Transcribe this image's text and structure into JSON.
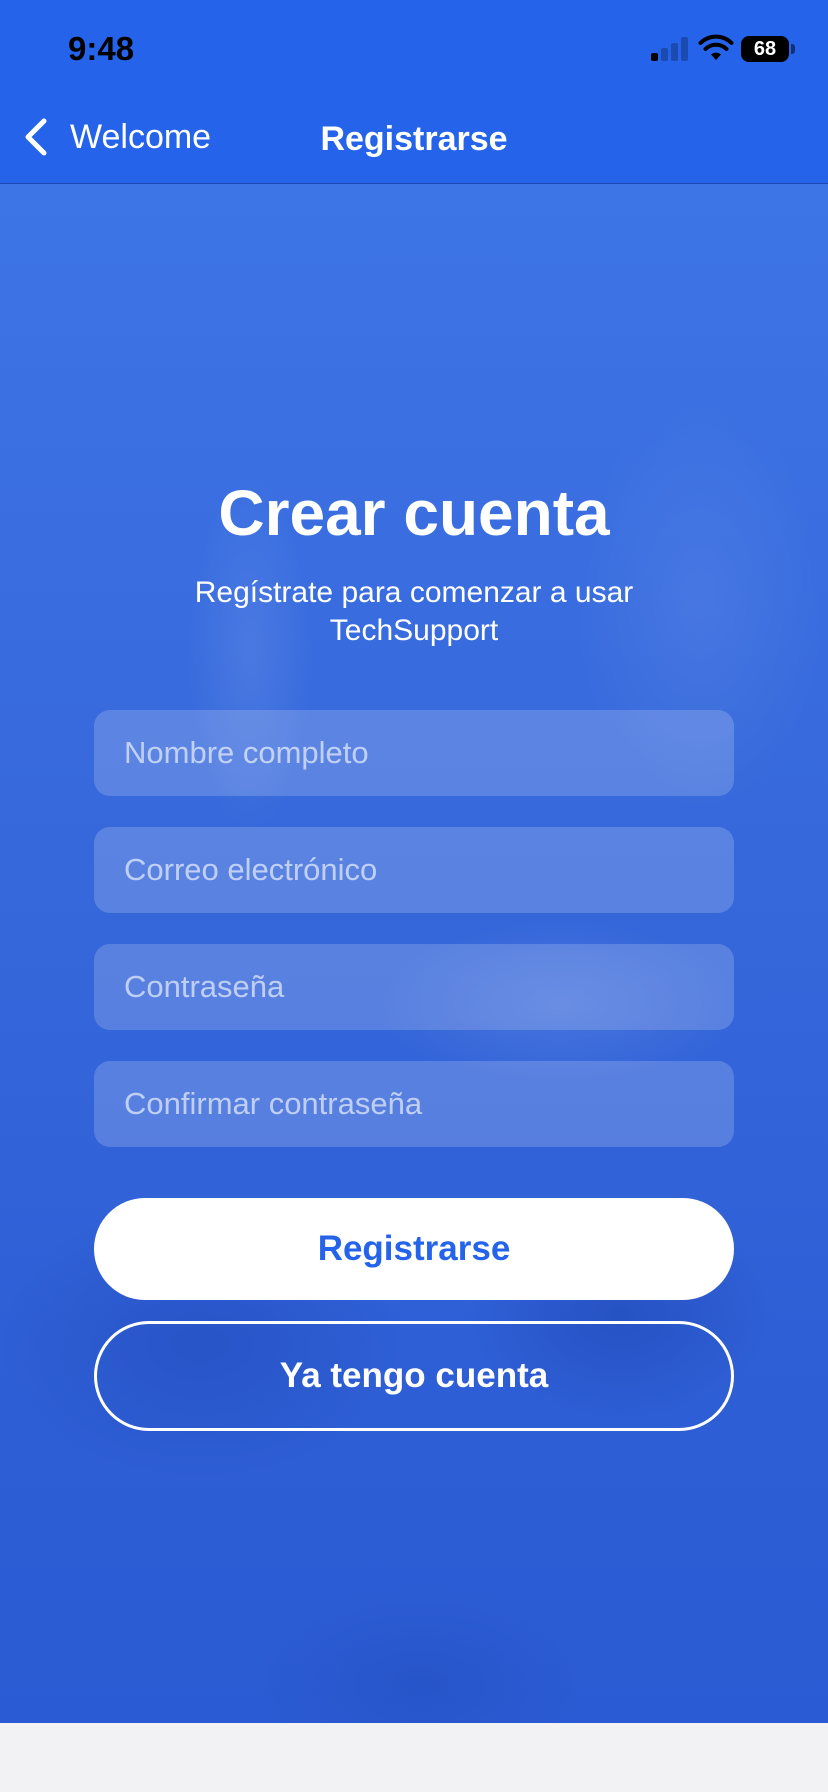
{
  "status_bar": {
    "time": "9:48",
    "battery": "68"
  },
  "nav": {
    "back_label": "Welcome",
    "title": "Registrarse"
  },
  "form": {
    "heading": "Crear cuenta",
    "subtitle": "Regístrate para comenzar a usar TechSupport",
    "fields": [
      {
        "placeholder": "Nombre completo",
        "value": ""
      },
      {
        "placeholder": "Correo electrónico",
        "value": ""
      },
      {
        "placeholder": "Contraseña",
        "value": ""
      },
      {
        "placeholder": "Confirmar contraseña",
        "value": ""
      }
    ],
    "primary_button": "Registrarse",
    "secondary_button": "Ya tengo cuenta"
  },
  "colors": {
    "accent": "#2563eb",
    "button_text": "#2563eb",
    "text": "#ffffff"
  },
  "icons": [
    "back-chevron-icon",
    "cellular-signal-icon",
    "wifi-icon",
    "battery-icon"
  ]
}
